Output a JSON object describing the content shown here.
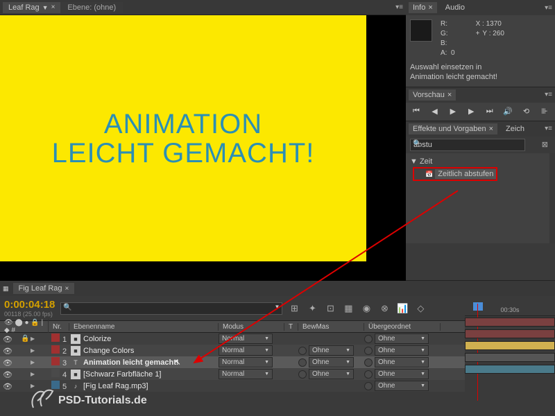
{
  "comp": {
    "tab_name": "Leaf Rag",
    "layer_label": "Ebene: (ohne)",
    "canvas_line1": "ANIMATION",
    "canvas_line2": "LEICHT GEMACHT!"
  },
  "info": {
    "tab_info": "Info",
    "tab_audio": "Audio",
    "r": "R:",
    "g": "G:",
    "b": "B:",
    "a": "A:",
    "a_val": "0",
    "x_label": "X :",
    "y_label": "Y :",
    "x_val": "1370",
    "y_val": "260",
    "line1": "Auswahl einsetzen in",
    "line2": "Animation leicht gemacht!"
  },
  "preview": {
    "tab": "Vorschau"
  },
  "effects": {
    "tab1": "Effekte und Vorgaben",
    "tab2": "Zeich",
    "search_value": "abstu",
    "cat_time": "Zeit",
    "item_time": "Zeitlich abstufen"
  },
  "timeline": {
    "tab": "Fig Leaf Rag",
    "timecode": "0:00:04:18",
    "timecode_sub": "00118 (25.00 fps)",
    "ruler_label": "00:30s",
    "cols": {
      "nr": "Nr.",
      "name": "Ebenenname",
      "mode": "Modus",
      "t": "T",
      "bew": "BewMas",
      "parent": "Übergeordnet"
    },
    "mode_normal": "Normal",
    "bew_none": "Ohne",
    "parent_none": "Ohne",
    "layers": [
      {
        "nr": "1",
        "name": "Colorize",
        "color": "#a03030",
        "icon": "■",
        "locked": true
      },
      {
        "nr": "2",
        "name": "Change Colors",
        "color": "#a03030",
        "icon": "■"
      },
      {
        "nr": "3",
        "name": "Animation leicht gemacht!",
        "color": "#a03030",
        "icon": "T",
        "selected": true
      },
      {
        "nr": "4",
        "name": "[Schwarz Farbfläche 1]",
        "color": "#4a4a4a",
        "icon": "■"
      },
      {
        "nr": "5",
        "name": "[Fig Leaf Rag.mp3]",
        "color": "#3a6a8a",
        "icon": "♪"
      }
    ]
  },
  "watermark": "PSD-Tutorials.de"
}
